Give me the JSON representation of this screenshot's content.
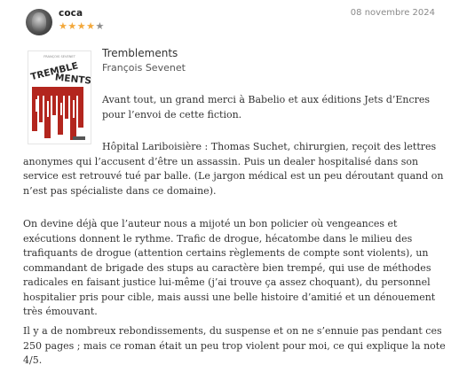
{
  "review": {
    "username": "coca",
    "date": "08 novembre 2024",
    "rating": {
      "value": 4,
      "max": 5
    },
    "colors": {
      "star_filled": "#f3a83b",
      "star_empty": "#8e8e8e",
      "accent": "#b3261e"
    }
  },
  "book": {
    "title": "Tremblements",
    "author": "François Sevenet",
    "cover": {
      "author": "FRANÇOIS SEVENET",
      "title_part1": "TREMBLE",
      "title_part2": "MENTS"
    }
  },
  "body": {
    "p1": "Avant tout, un grand merci à Babelio et aux éditions Jets d’Encres pour l’envoi de cette fiction.",
    "p2": "Hôpital Lariboisière : Thomas Suchet, chirurgien, reçoit des lettres anonymes qui l’accusent d’être un assassin. Puis un dealer hospitalisé dans son service est retrouvé tué par balle. (Le jargon médical est un peu déroutant quand on n’est pas spécialiste dans ce domaine).",
    "p3": "On devine déjà que l’auteur nous a mijoté un bon policier où vengeances et exécutions donnent le rythme. Trafic de drogue, hécatombe dans le milieu des trafiquants de drogue (attention certains règlements de compte sont violents), un commandant de brigade des stups au caractère bien trempé, qui use de méthodes radicales en faisant justice lui-même (j’ai trouve ça assez choquant), du personnel hospitalier pris pour cible, mais aussi une belle histoire d’amitié et un dénouement très émouvant.",
    "p4": "Il y a de nombreux rebondissements, du suspense et on ne s’ennuie pas pendant ces 250 pages ; mais ce roman était un peu trop violent pour moi, ce qui explique la note 4/5."
  }
}
